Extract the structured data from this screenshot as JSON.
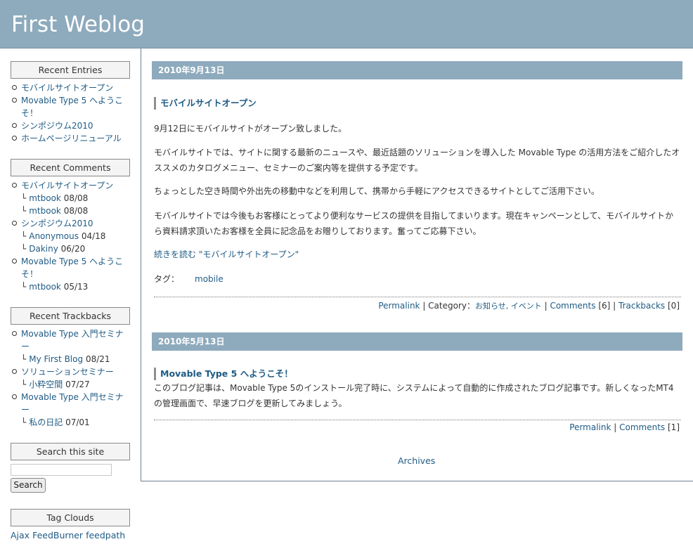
{
  "header": {
    "title": "First Weblog"
  },
  "sidebar": {
    "recent_entries": {
      "heading": "Recent Entries",
      "items": [
        {
          "label": "モバイルサイトオープン"
        },
        {
          "label": "Movable Type 5 へようこそ！"
        },
        {
          "label": "シンポジウム2010"
        },
        {
          "label": "ホームページリニューアル"
        }
      ]
    },
    "recent_comments": {
      "heading": "Recent Comments",
      "groups": [
        {
          "entry": "モバイルサイトオープン",
          "comments": [
            {
              "author": "mtbook",
              "date": "08/08"
            },
            {
              "author": "mtbook",
              "date": "08/08"
            }
          ]
        },
        {
          "entry": "シンポジウム2010",
          "comments": [
            {
              "author": "Anonymous",
              "date": "04/18"
            },
            {
              "author": "Dakiny",
              "date": "06/20"
            }
          ]
        },
        {
          "entry": "Movable Type 5 へようこそ！",
          "comments": [
            {
              "author": "mtbook",
              "date": "05/13"
            }
          ]
        }
      ]
    },
    "recent_trackbacks": {
      "heading": "Recent Trackbacks",
      "groups": [
        {
          "entry": "Movable Type 入門セミナー",
          "tb": {
            "source": "My First Blog",
            "date": "08/21"
          }
        },
        {
          "entry": "ソリューションセミナー",
          "tb": {
            "source": "小粋空間",
            "date": "07/27"
          }
        },
        {
          "entry": "Movable Type 入門セミナー",
          "tb": {
            "source": "私の日記",
            "date": "07/01"
          }
        }
      ]
    },
    "search": {
      "heading": "Search this site",
      "value": "",
      "button": "Search"
    },
    "tags": {
      "heading": "Tag Clouds",
      "items": [
        "Ajax",
        "FeedBurner",
        "feedpath"
      ]
    }
  },
  "posts": [
    {
      "date": "2010年9月13日",
      "title": "モバイルサイトオープン",
      "paragraphs": [
        "9月12日にモバイルサイトがオープン致しました。",
        "モバイルサイトでは、サイトに関する最新のニュースや、最近話題のソリューションを導入した Movable Type の活用方法をご紹介したオススメのカタログメニュー、セミナーのご案内等を提供する予定です。",
        "ちょっとした空き時間や外出先の移動中などを利用して、携帯から手軽にアクセスできるサイトとしてご活用下さい。",
        "モバイルサイトでは今後もお客様にとってより便利なサービスの提供を目指してまいります。現在キャンペーンとして、モバイルサイトから資料請求頂いたお客様を全員に記念品をお贈りしております。奮ってご応募下さい。"
      ],
      "read_more": "続きを読む \"モバイルサイトオープン\"",
      "tags_label": "タグ：",
      "tag": "mobile",
      "permalink": "Permalink",
      "category_label": "Category：",
      "categories": "お知らせ, イベント",
      "comments_label": "Comments",
      "comments_count": "[6]",
      "trackbacks_label": "Trackbacks",
      "trackbacks_count": "[0]"
    },
    {
      "date": "2010年5月13日",
      "title": "Movable Type 5 へようこそ！",
      "body": "このブログ記事は、Movable Type 5のインストール完了時に、システムによって自動的に作成されたブログ記事です。新しくなったMT4の管理画面で、早速ブログを更新してみましょう。",
      "permalink": "Permalink",
      "comments_label": "Comments",
      "comments_count": "[1]"
    }
  ],
  "archives": "Archives",
  "colors": {
    "header_bg": "#8eaabd",
    "link": "#1f5b85"
  }
}
